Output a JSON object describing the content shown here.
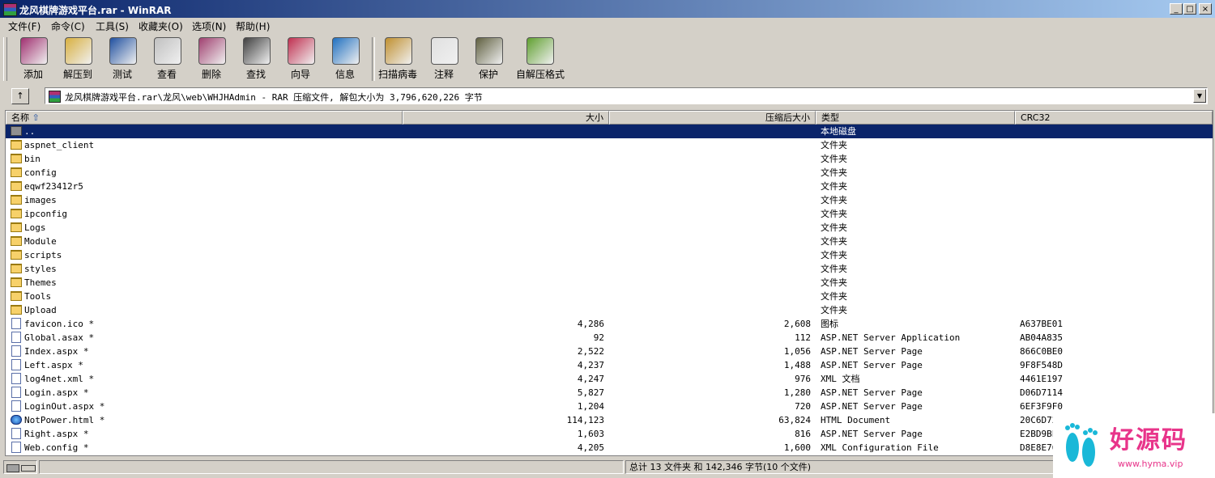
{
  "window": {
    "title": "龙风棋牌游戏平台.rar - WinRAR",
    "controls": [
      "_",
      "□",
      "×"
    ]
  },
  "menu": [
    "文件(F)",
    "命令(C)",
    "工具(S)",
    "收藏夹(O)",
    "选项(N)",
    "帮助(H)"
  ],
  "toolbar": [
    {
      "label": "添加",
      "icon": "add-books-icon",
      "color": "#a03070"
    },
    {
      "label": "解压到",
      "icon": "extract-folder-icon",
      "color": "#d8b040"
    },
    {
      "label": "测试",
      "icon": "test-checkmark-icon",
      "color": "#2050a0"
    },
    {
      "label": "查看",
      "icon": "view-glasses-icon",
      "color": "#c0c0c0"
    },
    {
      "label": "删除",
      "icon": "delete-recycle-icon",
      "color": "#a04070"
    },
    {
      "label": "查找",
      "icon": "find-binoculars-icon",
      "color": "#404040"
    },
    {
      "label": "向导",
      "icon": "wizard-icon",
      "color": "#c03050"
    },
    {
      "label": "信息",
      "icon": "info-icon",
      "color": "#2070c0"
    },
    {
      "label": "扫描病毒",
      "icon": "virus-scan-icon",
      "color": "#c09030"
    },
    {
      "label": "注释",
      "icon": "comment-icon",
      "color": "#e0e0e0"
    },
    {
      "label": "保护",
      "icon": "protect-shield-icon",
      "color": "#606040"
    },
    {
      "label": "自解压格式",
      "icon": "sfx-icon",
      "color": "#60a030"
    }
  ],
  "address": {
    "path": "龙风棋牌游戏平台.rar\\龙风\\web\\WHJHAdmin - RAR 压缩文件, 解包大小为 3,796,620,226 字节",
    "up_button": "↑"
  },
  "columns": {
    "name": "名称",
    "size": "大小",
    "packed": "压缩后大小",
    "type": "类型",
    "crc": "CRC32"
  },
  "rows": [
    {
      "name": "..",
      "size": "",
      "packed": "",
      "type": "本地磁盘",
      "crc": "",
      "kind": "folderup"
    },
    {
      "name": "aspnet_client",
      "size": "",
      "packed": "",
      "type": "文件夹",
      "crc": "",
      "kind": "folder"
    },
    {
      "name": "bin",
      "size": "",
      "packed": "",
      "type": "文件夹",
      "crc": "",
      "kind": "folder"
    },
    {
      "name": "config",
      "size": "",
      "packed": "",
      "type": "文件夹",
      "crc": "",
      "kind": "folder"
    },
    {
      "name": "eqwf23412r5",
      "size": "",
      "packed": "",
      "type": "文件夹",
      "crc": "",
      "kind": "folder"
    },
    {
      "name": "images",
      "size": "",
      "packed": "",
      "type": "文件夹",
      "crc": "",
      "kind": "folder"
    },
    {
      "name": "ipconfig",
      "size": "",
      "packed": "",
      "type": "文件夹",
      "crc": "",
      "kind": "folder"
    },
    {
      "name": "Logs",
      "size": "",
      "packed": "",
      "type": "文件夹",
      "crc": "",
      "kind": "folder"
    },
    {
      "name": "Module",
      "size": "",
      "packed": "",
      "type": "文件夹",
      "crc": "",
      "kind": "folder"
    },
    {
      "name": "scripts",
      "size": "",
      "packed": "",
      "type": "文件夹",
      "crc": "",
      "kind": "folder"
    },
    {
      "name": "styles",
      "size": "",
      "packed": "",
      "type": "文件夹",
      "crc": "",
      "kind": "folder"
    },
    {
      "name": "Themes",
      "size": "",
      "packed": "",
      "type": "文件夹",
      "crc": "",
      "kind": "folder"
    },
    {
      "name": "Tools",
      "size": "",
      "packed": "",
      "type": "文件夹",
      "crc": "",
      "kind": "folder"
    },
    {
      "name": "Upload",
      "size": "",
      "packed": "",
      "type": "文件夹",
      "crc": "",
      "kind": "folder"
    },
    {
      "name": "favicon.ico *",
      "size": "4,286",
      "packed": "2,608",
      "type": "图标",
      "crc": "A637BE01",
      "kind": "file"
    },
    {
      "name": "Global.asax *",
      "size": "92",
      "packed": "112",
      "type": "ASP.NET Server Application",
      "crc": "AB04A835",
      "kind": "file"
    },
    {
      "name": "Index.aspx *",
      "size": "2,522",
      "packed": "1,056",
      "type": "ASP.NET Server Page",
      "crc": "866C0BE0",
      "kind": "file"
    },
    {
      "name": "Left.aspx *",
      "size": "4,237",
      "packed": "1,488",
      "type": "ASP.NET Server Page",
      "crc": "9F8F548D",
      "kind": "file"
    },
    {
      "name": "log4net.xml *",
      "size": "4,247",
      "packed": "976",
      "type": "XML 文档",
      "crc": "4461E197",
      "kind": "file"
    },
    {
      "name": "Login.aspx *",
      "size": "5,827",
      "packed": "1,280",
      "type": "ASP.NET Server Page",
      "crc": "D06D7114",
      "kind": "file"
    },
    {
      "name": "LoginOut.aspx *",
      "size": "1,204",
      "packed": "720",
      "type": "ASP.NET Server Page",
      "crc": "6EF3F9F0",
      "kind": "file"
    },
    {
      "name": "NotPower.html *",
      "size": "114,123",
      "packed": "63,824",
      "type": "HTML Document",
      "crc": "20C6D72",
      "kind": "globe"
    },
    {
      "name": "Right.aspx *",
      "size": "1,603",
      "packed": "816",
      "type": "ASP.NET Server Page",
      "crc": "E2BD9BE",
      "kind": "file"
    },
    {
      "name": "Web.config *",
      "size": "4,205",
      "packed": "1,600",
      "type": "XML Configuration File",
      "crc": "D8E8E76",
      "kind": "file"
    }
  ],
  "status": {
    "summary": "总计 13 文件夹 和 142,346 字节(10 个文件)"
  },
  "watermark": {
    "text": "好源码",
    "url": "www.hyma.vip"
  }
}
